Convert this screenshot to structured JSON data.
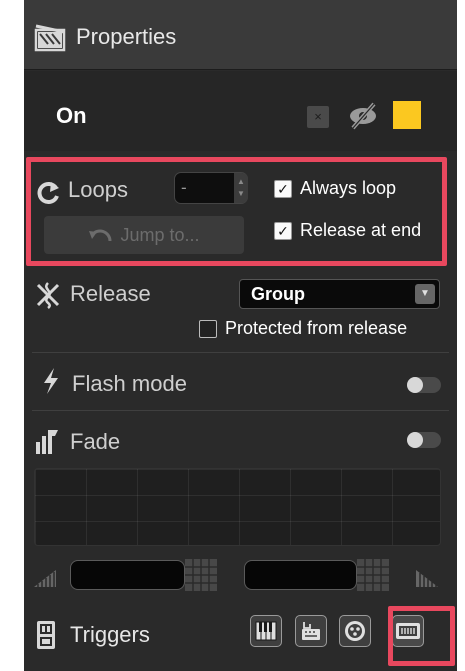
{
  "header": {
    "title": "Properties",
    "icon": "clapperboard-icon"
  },
  "cue": {
    "name": "On",
    "clear_label": "×",
    "color": "#fbc820"
  },
  "loops": {
    "label": "Loops",
    "value": "-",
    "jump_label": "Jump to...",
    "always_loop_label": "Always loop",
    "always_loop_checked": true,
    "release_at_end_label": "Release at end",
    "release_at_end_checked": true
  },
  "release": {
    "label": "Release",
    "selected": "Group",
    "protected_label": "Protected from release",
    "protected_checked": false
  },
  "flash": {
    "label": "Flash mode",
    "enabled": false
  },
  "fade": {
    "label": "Fade",
    "enabled": false
  },
  "triggers": {
    "label": "Triggers",
    "buttons": [
      "piano-keys-icon",
      "keyboard-icon",
      "dmx-connector-icon",
      "timecode-icon"
    ]
  },
  "colors": {
    "highlight": "#e8485e",
    "accent": "#fbc820"
  }
}
